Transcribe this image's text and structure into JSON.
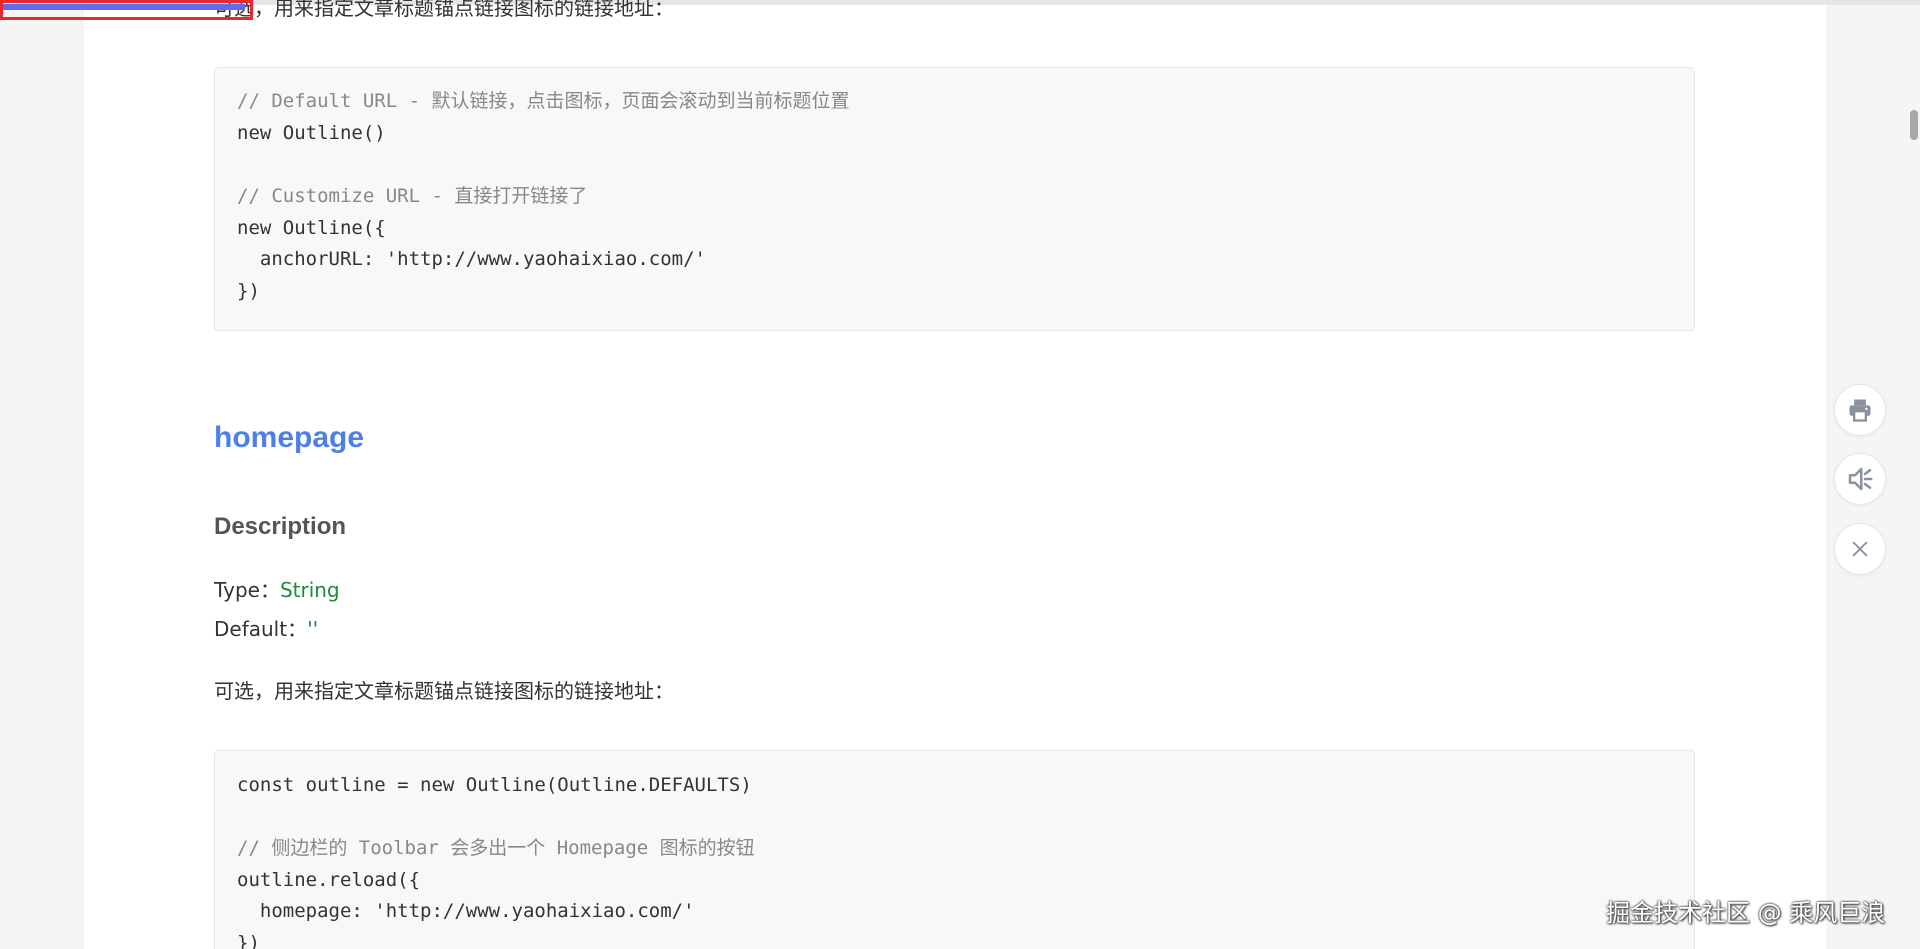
{
  "header": {
    "cut_paragraph": "可选，用来指定文章标题锚点链接图标的链接地址："
  },
  "progress": {
    "fraction": 0.22
  },
  "code_block_1": {
    "lines": [
      "// Default URL - 默认链接，点击图标，页面会滚动到当前标题位置",
      "new Outline()",
      "",
      "// Customize URL - 直接打开链接了",
      "new Outline({",
      "  anchorURL: 'http://www.yaohaixiao.com/'",
      "})"
    ]
  },
  "section": {
    "heading": "homepage",
    "subheading": "Description",
    "type_label": "Type：",
    "type_value": "String",
    "default_label": "Default：",
    "default_value": "''",
    "paragraph": "可选，用来指定文章标题锚点链接图标的链接地址："
  },
  "code_block_2": {
    "lines": [
      "const outline = new Outline(Outline.DEFAULTS)",
      "",
      "// 侧边栏的 Toolbar 会多出一个 Homepage 图标的按钮",
      "outline.reload({",
      "  homepage: 'http://www.yaohaixiao.com/'",
      "})"
    ]
  },
  "floating_tools": {
    "print_icon": "print-icon",
    "mute_icon": "speaker-mute-icon",
    "close_icon": "close-icon"
  },
  "watermark": "掘金技术社区 @ 乘风巨浪",
  "colors": {
    "heading_blue": "#4e7ee8",
    "value_green": "#1f8a3a",
    "progress_blue": "#5b6ee8",
    "highlight_red": "#e8282d"
  }
}
